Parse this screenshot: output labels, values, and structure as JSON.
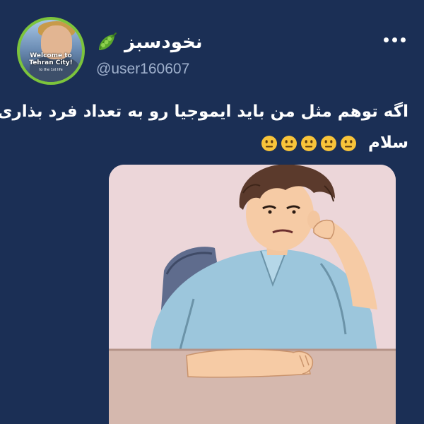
{
  "post": {
    "author": {
      "display_name": "نخودسبز",
      "handle": "@user160607",
      "name_emoji": "pea-pod-icon",
      "avatar": {
        "caption": "Welcome to\nTehran City!",
        "subcaption": "to the 1st life"
      }
    },
    "menu_icon": "more-options-icon",
    "text": {
      "line1": "اگه توهم مثل من باید ایموجیا رو به تعداد فرد بذاری",
      "line2": "سلام",
      "emoji": "neutral-face",
      "emoji_count": 5
    },
    "media": {
      "description_icon": "bored-man-leaning-on-desk-image"
    }
  },
  "colors": {
    "background": "#1b2f55",
    "text": "#ffffff",
    "handle": "#9fb0cc",
    "avatar_ring": "#7cc43c",
    "emoji_yellow": "#f8c43a"
  }
}
